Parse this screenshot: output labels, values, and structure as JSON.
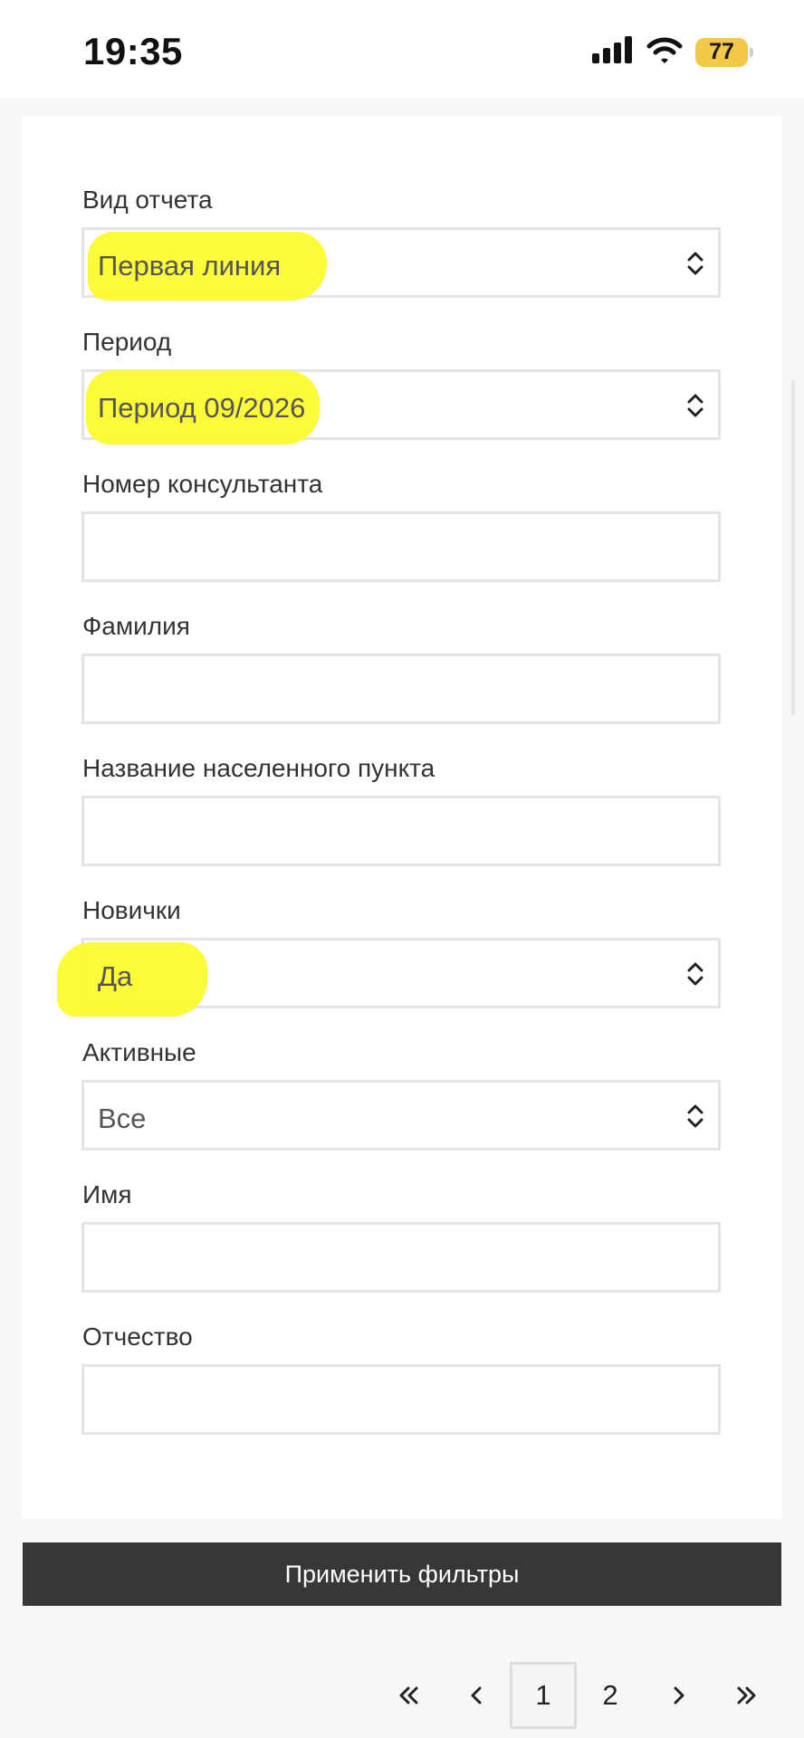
{
  "status_bar": {
    "time": "19:35",
    "battery": "77",
    "icons": [
      "cellular-signal-icon",
      "wifi-icon",
      "battery-icon"
    ]
  },
  "filters": {
    "report_type": {
      "label": "Вид отчета",
      "value": "Первая линия"
    },
    "period": {
      "label": "Период",
      "value": "Период 09/2026"
    },
    "consultant_number": {
      "label": "Номер консультанта",
      "value": ""
    },
    "last_name": {
      "label": "Фамилия",
      "value": ""
    },
    "city": {
      "label": "Название населенного пункта",
      "value": ""
    },
    "newcomers": {
      "label": "Новички",
      "value": "Да"
    },
    "active": {
      "label": "Активные",
      "value": "Все"
    },
    "first_name": {
      "label": "Имя",
      "value": ""
    },
    "middle_name": {
      "label": "Отчество",
      "value": ""
    }
  },
  "apply_button": {
    "label": "Применить фильтры"
  },
  "pagination": {
    "first_icon": "double-chevron-left-icon",
    "prev_icon": "chevron-left-icon",
    "pages": [
      "1",
      "2"
    ],
    "current": "1",
    "next_icon": "chevron-right-icon",
    "last_icon": "double-chevron-right-icon"
  },
  "colors": {
    "highlight": "#fbfb2e",
    "button_bg": "#373737",
    "battery": "#f4c94a"
  }
}
